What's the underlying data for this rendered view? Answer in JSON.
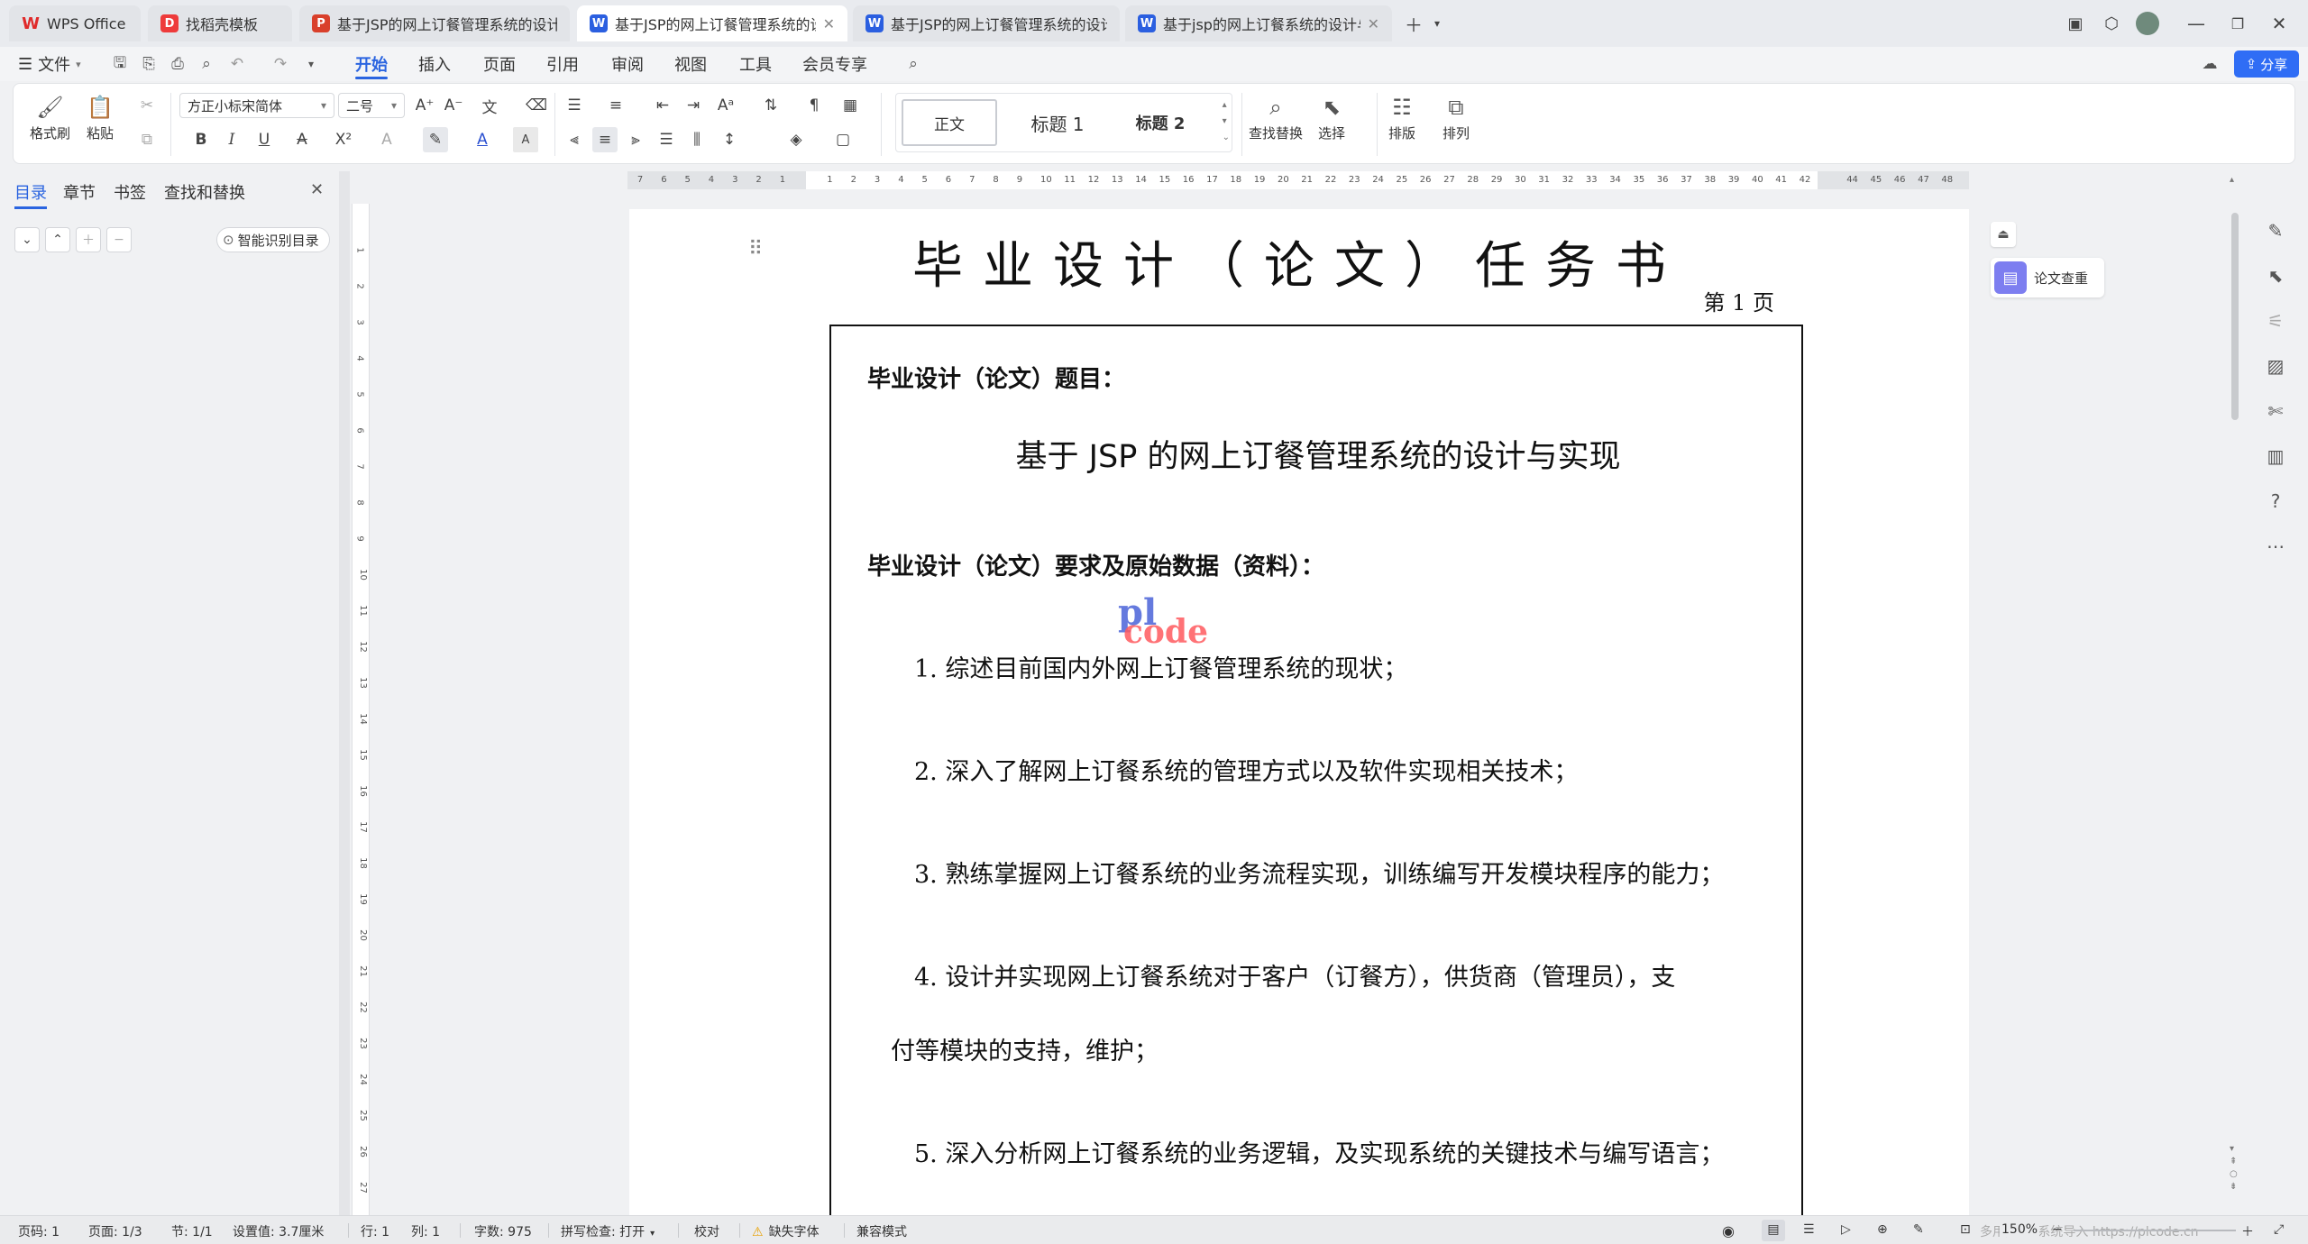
{
  "tabs": [
    {
      "label": "WPS Office",
      "icon": "W",
      "color": "#e02a2a",
      "active": false,
      "closable": false
    },
    {
      "label": "找稻壳模板",
      "icon": "D",
      "color": "#ee3b3b",
      "active": false,
      "closable": false
    },
    {
      "label": "基于JSP的网上订餐管理系统的设计与",
      "icon": "P",
      "color": "#d9402b",
      "active": false,
      "closable": false
    },
    {
      "label": "基于JSP的网上订餐管理系统的设计",
      "icon": "W",
      "color": "#2b5fe0",
      "active": true,
      "closable": true
    },
    {
      "label": "基于JSP的网上订餐管理系统的设计与",
      "icon": "W",
      "color": "#2b5fe0",
      "active": false,
      "closable": false
    },
    {
      "label": "基于jsp的网上订餐系统的设计与实",
      "icon": "W",
      "color": "#2b5fe0",
      "active": false,
      "closable": true
    }
  ],
  "menu": {
    "file": "文件",
    "items": [
      "开始",
      "插入",
      "页面",
      "引用",
      "审阅",
      "视图",
      "工具",
      "会员专享"
    ],
    "share": "分享"
  },
  "ribbon": {
    "format_painter": "格式刷",
    "paste": "粘贴",
    "font_name": "方正小标宋简体",
    "font_size": "二号",
    "styles": [
      "正文",
      "标题 1",
      "标题 2"
    ],
    "find_replace": "查找替换",
    "select": "选择",
    "typeset": "排版",
    "arrange": "排列"
  },
  "left_panel": {
    "tabs": [
      "目录",
      "章节",
      "书签",
      "查找和替换"
    ],
    "smart_toc": "智能识别目录"
  },
  "ruler": {
    "h_left": [
      "7",
      "6",
      "5",
      "4",
      "3",
      "2",
      "1"
    ],
    "h_main": [
      "1",
      "2",
      "3",
      "4",
      "5",
      "6",
      "7",
      "8",
      "9",
      "10",
      "11",
      "12",
      "13",
      "14",
      "15",
      "16",
      "17",
      "18",
      "19",
      "20",
      "21",
      "22",
      "23",
      "24",
      "25",
      "26",
      "27",
      "28",
      "29",
      "30",
      "31",
      "32",
      "33",
      "34",
      "35",
      "36",
      "37",
      "38",
      "39",
      "40",
      "41",
      "42"
    ],
    "h_right": [
      "44",
      "45",
      "46",
      "47",
      "48"
    ],
    "v": [
      "1",
      "2",
      "3",
      "4",
      "5",
      "6",
      "7",
      "8",
      "9",
      "10",
      "11",
      "12",
      "13",
      "14",
      "15",
      "16",
      "17",
      "18",
      "19",
      "20",
      "21",
      "22",
      "23",
      "24",
      "25",
      "26",
      "27"
    ]
  },
  "document": {
    "title": "毕业设计（论文）任务书",
    "page_label": "第 1 页",
    "topic_label": "毕业设计（论文）题目：",
    "topic": "基于 JSP 的网上订餐管理系统的设计与实现",
    "requirements_label": "毕业设计（论文）要求及原始数据（资料）：",
    "items": [
      "1. 综述目前国内外网上订餐管理系统的现状；",
      "2. 深入了解网上订餐系统的管理方式以及软件实现相关技术；",
      "3. 熟练掌握网上订餐系统的业务流程实现，训练编写开发模块程序的能力；",
      "4. 设计并实现网上订餐系统对于客户（订餐方），供货商（管理员），支",
      "付等模块的支持，维护；",
      "5. 深入分析网上订餐系统的业务逻辑，及实现系统的关键技术与编写语言；"
    ],
    "watermark_top": "pl",
    "watermark_bottom": "code"
  },
  "review_button": "论文查重",
  "status": {
    "page_num": "页码: 1",
    "pages": "页面: 1/3",
    "section": "节: 1/1",
    "setting": "设置值: 3.7厘米",
    "row": "行: 1",
    "col": "列: 1",
    "words": "字数: 975",
    "spell": "拼写检查: 打开",
    "proof": "校对",
    "missing_font": "缺失字体",
    "compat": "兼容模式",
    "zoom": "150%",
    "overlay": "多用户 Ai 系统导入 https://plcode.cn"
  }
}
